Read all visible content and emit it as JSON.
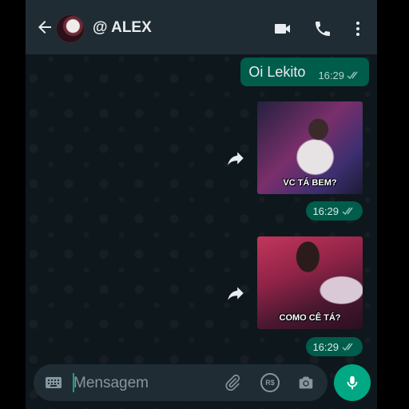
{
  "header": {
    "contact_name": "@ ALEX",
    "icons": [
      "back-arrow-icon",
      "video-call-icon",
      "voice-call-icon",
      "more-options-icon"
    ]
  },
  "messages": [
    {
      "type": "text",
      "text": "Oi Lekito",
      "time": "16:29",
      "status": "read-double-check"
    },
    {
      "type": "sticker",
      "caption": "VC TÁ BEM?",
      "time": "16:29",
      "status": "read-double-check"
    },
    {
      "type": "sticker",
      "caption": "COMO CÊ TÁ?",
      "time": "16:29",
      "status": "read-double-check"
    }
  ],
  "composer": {
    "placeholder": "Mensagem",
    "payment_symbol": "R$"
  },
  "colors": {
    "header_bg": "#1f2c34",
    "outgoing_bubble": "#005c4b",
    "accent": "#00a884",
    "chat_bg": "#0b141a"
  }
}
